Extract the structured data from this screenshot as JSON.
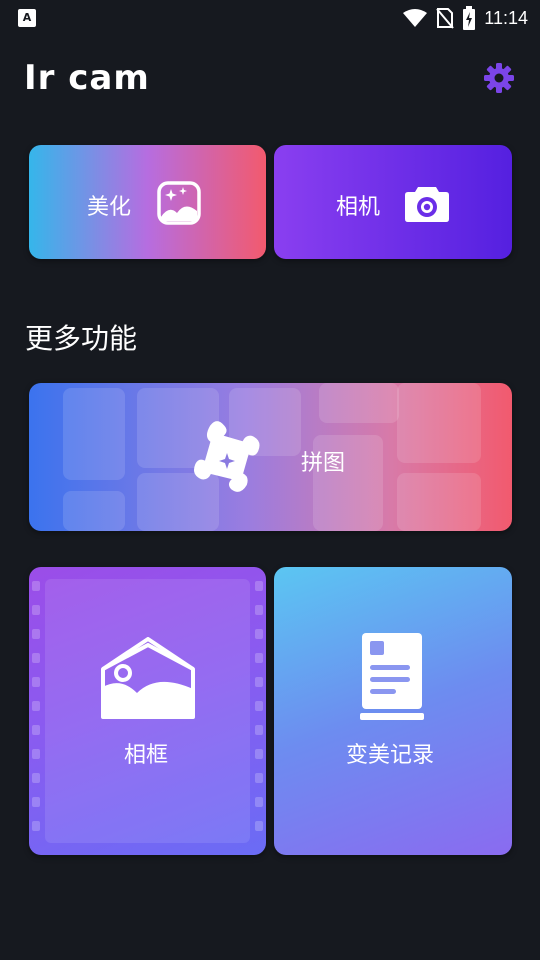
{
  "status_bar": {
    "left_icon": "A",
    "time": "11:14",
    "icons": [
      "wifi-icon",
      "no-sim-icon",
      "battery-charging-icon"
    ]
  },
  "header": {
    "title": "Ir cam",
    "settings_icon": "gear-icon"
  },
  "cards": {
    "beauty": {
      "label": "美化",
      "icon": "image-sparkle-icon"
    },
    "camera": {
      "label": "相机",
      "icon": "camera-icon"
    }
  },
  "section": {
    "title": "更多功能"
  },
  "features": {
    "collage": {
      "label": "拼图",
      "icon": "puzzle-icon"
    },
    "frame": {
      "label": "相框",
      "icon": "picture-frame-icon"
    },
    "record": {
      "label": "变美记录",
      "icon": "document-icon"
    }
  },
  "colors": {
    "background": "#16191f",
    "accent": "#7b45e8",
    "beauty_gradient": [
      "#35b6ea",
      "#b66de0",
      "#f25a6e"
    ],
    "camera_gradient": [
      "#8a3ff0",
      "#5520e0"
    ]
  }
}
